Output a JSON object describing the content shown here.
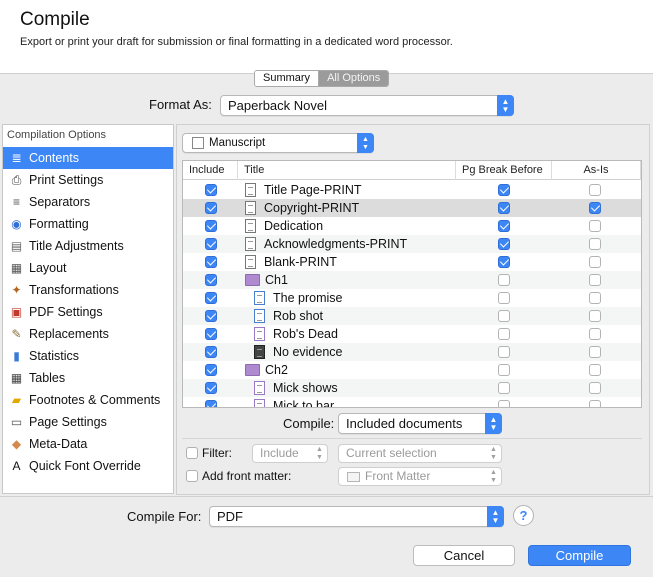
{
  "header": {
    "title": "Compile",
    "subtitle": "Export or print your draft for submission or final formatting in a dedicated word processor."
  },
  "segment": {
    "summary": "Summary",
    "all_options": "All Options"
  },
  "format_as": {
    "label": "Format As:",
    "value": "Paperback Novel"
  },
  "sidebar": {
    "heading": "Compilation Options",
    "items": [
      {
        "label": "Contents",
        "icon": "contents-icon",
        "glyph": "≣",
        "color": "#fff",
        "selected": true
      },
      {
        "label": "Print Settings",
        "icon": "printer-icon",
        "glyph": "⎙",
        "color": "#444"
      },
      {
        "label": "Separators",
        "icon": "separators-icon",
        "glyph": "≡",
        "color": "#555"
      },
      {
        "label": "Formatting",
        "icon": "formatting-icon",
        "glyph": "◉",
        "color": "#2f6fd6"
      },
      {
        "label": "Title Adjustments",
        "icon": "title-adjust-icon",
        "glyph": "▤",
        "color": "#666"
      },
      {
        "label": "Layout",
        "icon": "layout-icon",
        "glyph": "▦",
        "color": "#555"
      },
      {
        "label": "Transformations",
        "icon": "transform-icon",
        "glyph": "✦",
        "color": "#b5651d"
      },
      {
        "label": "PDF Settings",
        "icon": "pdf-icon",
        "glyph": "▣",
        "color": "#c0392b"
      },
      {
        "label": "Replacements",
        "icon": "replace-icon",
        "glyph": "✎",
        "color": "#8a6d3b"
      },
      {
        "label": "Statistics",
        "icon": "statistics-icon",
        "glyph": "▮",
        "color": "#3a7bd5"
      },
      {
        "label": "Tables",
        "icon": "tables-icon",
        "glyph": "▦",
        "color": "#444"
      },
      {
        "label": "Footnotes & Comments",
        "icon": "footnote-icon",
        "glyph": "▰",
        "color": "#e0a800"
      },
      {
        "label": "Page Settings",
        "icon": "page-settings-icon",
        "glyph": "▭",
        "color": "#555"
      },
      {
        "label": "Meta-Data",
        "icon": "tag-icon",
        "glyph": "◆",
        "color": "#d4884a"
      },
      {
        "label": "Quick Font Override",
        "icon": "font-icon",
        "glyph": "A",
        "color": "#111"
      }
    ]
  },
  "manuscript": {
    "value": "Manuscript"
  },
  "table": {
    "columns": [
      "Include",
      "Title",
      "Pg Break Before",
      "As-Is"
    ],
    "rows": [
      {
        "title": "Title Page-PRINT",
        "indent": 0,
        "type": "doc",
        "include": true,
        "pgbreak": true,
        "asis": false
      },
      {
        "title": "Copyright-PRINT",
        "indent": 0,
        "type": "doc",
        "include": true,
        "pgbreak": true,
        "asis": true,
        "highlight": true
      },
      {
        "title": "Dedication",
        "indent": 0,
        "type": "doc",
        "include": true,
        "pgbreak": true,
        "asis": false
      },
      {
        "title": "Acknowledgments-PRINT",
        "indent": 0,
        "type": "doc",
        "include": true,
        "pgbreak": true,
        "asis": false
      },
      {
        "title": "Blank-PRINT",
        "indent": 0,
        "type": "doc",
        "include": true,
        "pgbreak": true,
        "asis": false
      },
      {
        "title": "Ch1",
        "indent": 0,
        "type": "folder",
        "include": true,
        "pgbreak": false,
        "asis": false
      },
      {
        "title": "The promise",
        "indent": 1,
        "type": "blue",
        "include": true,
        "pgbreak": false,
        "asis": false
      },
      {
        "title": "Rob shot",
        "indent": 1,
        "type": "blue",
        "include": true,
        "pgbreak": false,
        "asis": false
      },
      {
        "title": "Rob's Dead",
        "indent": 1,
        "type": "purple",
        "include": true,
        "pgbreak": false,
        "asis": false
      },
      {
        "title": "No evidence",
        "indent": 1,
        "type": "dark",
        "include": true,
        "pgbreak": false,
        "asis": false
      },
      {
        "title": "Ch2",
        "indent": 0,
        "type": "folder",
        "include": true,
        "pgbreak": false,
        "asis": false
      },
      {
        "title": "Mick shows",
        "indent": 1,
        "type": "purple",
        "include": true,
        "pgbreak": false,
        "asis": false
      },
      {
        "title": "Mick to bar",
        "indent": 1,
        "type": "purple",
        "include": true,
        "pgbreak": false,
        "asis": false
      }
    ]
  },
  "compile": {
    "label": "Compile:",
    "value": "Included documents"
  },
  "filter": {
    "label": "Filter:",
    "mode": "Include",
    "selection": "Current selection"
  },
  "front_matter": {
    "label": "Add front matter:",
    "value": "Front Matter"
  },
  "compile_for": {
    "label": "Compile For:",
    "value": "PDF"
  },
  "help_glyph": "?",
  "buttons": {
    "cancel": "Cancel",
    "compile": "Compile"
  }
}
